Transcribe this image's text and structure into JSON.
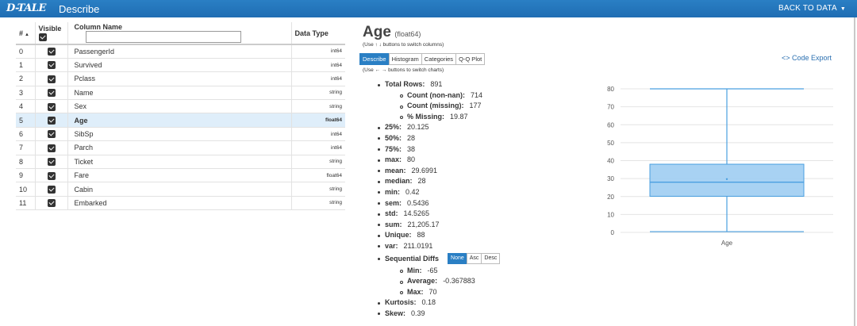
{
  "app": {
    "logo": "D-TALE",
    "title": "Describe",
    "back_label": "BACK TO DATA",
    "back_caret": "▼"
  },
  "table": {
    "headers": {
      "idx": "#",
      "sort": "▲",
      "visible": "Visible",
      "name": "Column Name",
      "type": "Data Type"
    },
    "filter_value": "",
    "rows": [
      {
        "idx": "0",
        "name": "PassengerId",
        "type": "int64"
      },
      {
        "idx": "1",
        "name": "Survived",
        "type": "int64"
      },
      {
        "idx": "2",
        "name": "Pclass",
        "type": "int64"
      },
      {
        "idx": "3",
        "name": "Name",
        "type": "string"
      },
      {
        "idx": "4",
        "name": "Sex",
        "type": "string"
      },
      {
        "idx": "5",
        "name": "Age",
        "type": "float64"
      },
      {
        "idx": "6",
        "name": "SibSp",
        "type": "int64"
      },
      {
        "idx": "7",
        "name": "Parch",
        "type": "int64"
      },
      {
        "idx": "8",
        "name": "Ticket",
        "type": "string"
      },
      {
        "idx": "9",
        "name": "Fare",
        "type": "float64"
      },
      {
        "idx": "10",
        "name": "Cabin",
        "type": "string"
      },
      {
        "idx": "11",
        "name": "Embarked",
        "type": "string"
      }
    ],
    "selected_index": 5
  },
  "detail": {
    "column": "Age",
    "dtype": "(float64)",
    "hint_columns": "(Use ↑ ↓ buttons to switch columns)",
    "tabs": [
      "Describe",
      "Histogram",
      "Categories",
      "Q-Q Plot"
    ],
    "active_tab": "Describe",
    "hint_charts": "(Use ← → buttons to switch charts)",
    "code_export": "<> Code Export"
  },
  "stats": {
    "total_rows": {
      "label": "Total Rows:",
      "value": "891"
    },
    "count": {
      "label": "Count (non-nan):",
      "value": "714"
    },
    "missing": {
      "label": "Count (missing):",
      "value": "177"
    },
    "pct_missing": {
      "label": "% Missing:",
      "value": "19.87"
    },
    "p25": {
      "label": "25%:",
      "value": "20.125"
    },
    "p50": {
      "label": "50%:",
      "value": "28"
    },
    "p75": {
      "label": "75%:",
      "value": "38"
    },
    "max": {
      "label": "max:",
      "value": "80"
    },
    "mean": {
      "label": "mean:",
      "value": "29.6991"
    },
    "median": {
      "label": "median:",
      "value": "28"
    },
    "min": {
      "label": "min:",
      "value": "0.42"
    },
    "sem": {
      "label": "sem:",
      "value": "0.5436"
    },
    "std": {
      "label": "std:",
      "value": "14.5265"
    },
    "sum": {
      "label": "sum:",
      "value": "21,205.17"
    },
    "unique": {
      "label": "Unique:",
      "value": "88"
    },
    "var": {
      "label": "var:",
      "value": "211.0191"
    },
    "seq": {
      "label": "Sequential Diffs",
      "buttons": [
        "None",
        "Asc",
        "Desc"
      ],
      "active": "None"
    },
    "seq_min": {
      "label": "Min:",
      "value": "-65"
    },
    "seq_avg": {
      "label": "Average:",
      "value": "-0.367883"
    },
    "seq_max": {
      "label": "Max:",
      "value": "70"
    },
    "kurtosis": {
      "label": "Kurtosis:",
      "value": "0.18"
    },
    "skew": {
      "label": "Skew:",
      "value": "0.39"
    }
  },
  "colors": {
    "accent": "#2a7fc4",
    "box_fill": "#9fcdf2",
    "box_stroke": "#4a9fe0",
    "selected_row": "#dfeefa"
  },
  "chart_data": {
    "type": "box",
    "categories": [
      "Age"
    ],
    "box": {
      "min": 0.42,
      "q1": 20.125,
      "median": 28,
      "q3": 38,
      "max": 80,
      "mean": 29.6991
    },
    "ylim": [
      0,
      80
    ],
    "yticks": [
      0,
      10,
      20,
      30,
      40,
      50,
      60,
      70,
      80
    ],
    "grid": true
  }
}
